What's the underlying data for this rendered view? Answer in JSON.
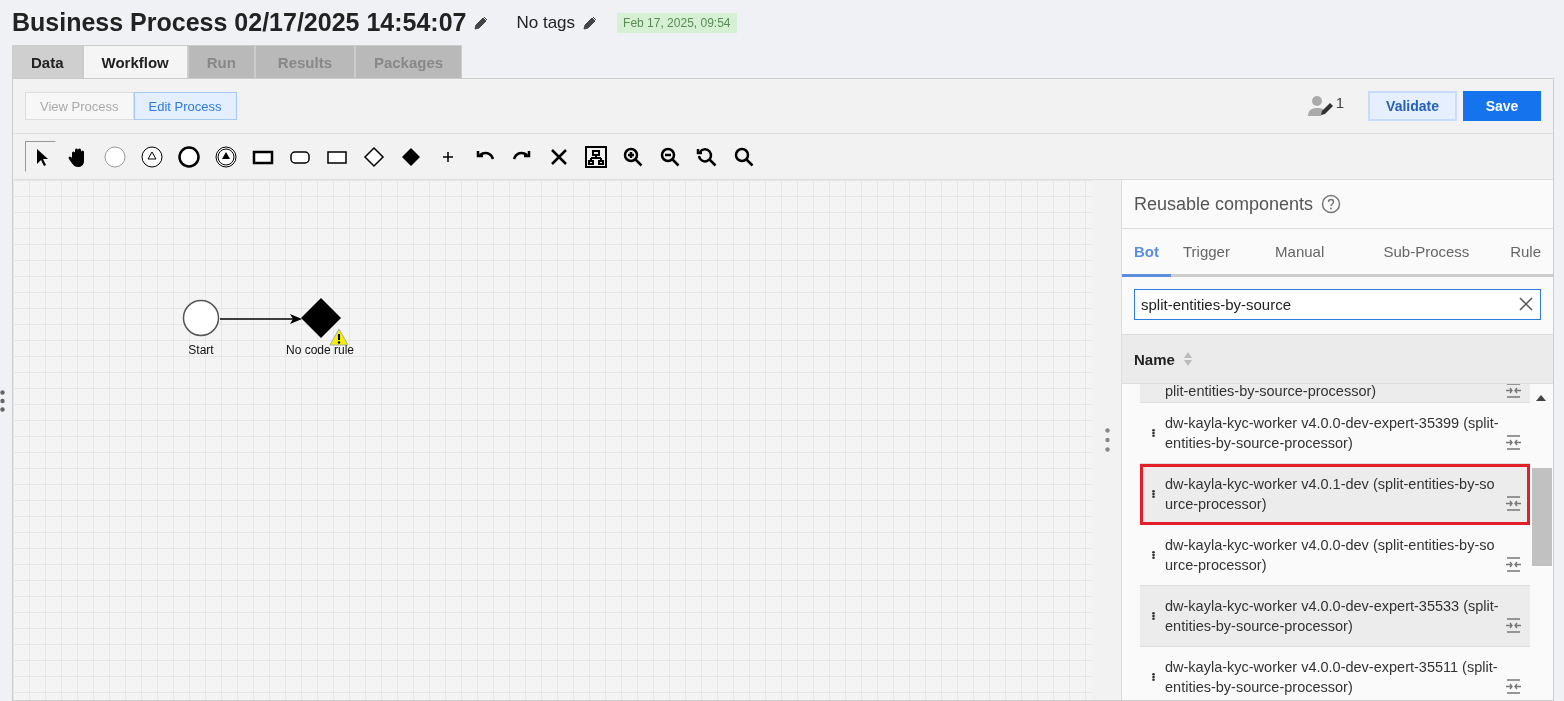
{
  "header": {
    "title": "Business Process 02/17/2025 14:54:07",
    "tags": "No tags",
    "timestamp": "Feb 17, 2025, 09:54"
  },
  "tabs": [
    {
      "label": "Data",
      "selected": false,
      "disabled": false
    },
    {
      "label": "Workflow",
      "selected": true,
      "disabled": false
    },
    {
      "label": "Run",
      "selected": false,
      "disabled": true
    },
    {
      "label": "Results",
      "selected": false,
      "disabled": true
    },
    {
      "label": "Packages",
      "selected": false,
      "disabled": true
    }
  ],
  "modes": [
    {
      "label": "View Process",
      "selected": false
    },
    {
      "label": "Edit Process",
      "selected": true
    }
  ],
  "editors_count": "1",
  "actions": [
    {
      "label": "Validate",
      "kind": "secondary"
    },
    {
      "label": "Save",
      "kind": "primary"
    }
  ],
  "tools": [
    {
      "kind": "pointer",
      "selected": true
    },
    {
      "kind": "hand",
      "selected": false
    },
    {
      "kind": "start-event",
      "selected": false
    },
    {
      "kind": "signal-event",
      "selected": false
    },
    {
      "kind": "end-event",
      "selected": false
    },
    {
      "kind": "throw-event",
      "selected": false
    },
    {
      "kind": "task",
      "selected": false
    },
    {
      "kind": "subprocess",
      "selected": false
    },
    {
      "kind": "plain-task",
      "selected": false
    },
    {
      "kind": "gateway",
      "selected": false
    },
    {
      "kind": "filled-gateway",
      "selected": false
    },
    {
      "kind": "plus",
      "selected": false
    },
    {
      "kind": "undo",
      "selected": false
    },
    {
      "kind": "redo",
      "selected": false
    },
    {
      "kind": "delete",
      "selected": false
    },
    {
      "kind": "layout",
      "selected": false
    },
    {
      "kind": "zoom-in",
      "selected": false
    },
    {
      "kind": "zoom-out",
      "selected": false
    },
    {
      "kind": "zoom-reset",
      "selected": false
    },
    {
      "kind": "zoom",
      "selected": false
    }
  ],
  "diagram": {
    "nodes": [
      {
        "kind": "start",
        "label": "Start",
        "warning": false
      },
      {
        "kind": "gateway",
        "label": "No code rule",
        "warning": true
      }
    ]
  },
  "sidebar": {
    "title": "Reusable components",
    "tabs": [
      {
        "label": "Bot",
        "selected": true
      },
      {
        "label": "Trigger",
        "selected": false
      },
      {
        "label": "Manual",
        "selected": false
      },
      {
        "label": "Sub-Process",
        "selected": false
      },
      {
        "label": "Rule",
        "selected": false
      }
    ],
    "search": {
      "value": "split-entities-by-source"
    },
    "column": "Name",
    "rows": [
      {
        "name": "plit-entities-by-source-processor)",
        "shaded": true,
        "outlined": false,
        "partial": true
      },
      {
        "name": "dw-kayla-kyc-worker v4.0.0-dev-expert-35399 (split-entities-by-source-processor)",
        "shaded": false,
        "outlined": false,
        "partial": false
      },
      {
        "name": "dw-kayla-kyc-worker v4.0.1-dev (split-entities-by-source-processor)",
        "shaded": true,
        "outlined": true,
        "partial": false
      },
      {
        "name": "dw-kayla-kyc-worker v4.0.0-dev (split-entities-by-source-processor)",
        "shaded": false,
        "outlined": false,
        "partial": false
      },
      {
        "name": "dw-kayla-kyc-worker v4.0.0-dev-expert-35533 (split-entities-by-source-processor)",
        "shaded": true,
        "outlined": false,
        "partial": false
      },
      {
        "name": "dw-kayla-kyc-worker v4.0.0-dev-expert-35511 (split-entities-by-source-processor)",
        "shaded": false,
        "outlined": false,
        "partial": false
      }
    ]
  }
}
